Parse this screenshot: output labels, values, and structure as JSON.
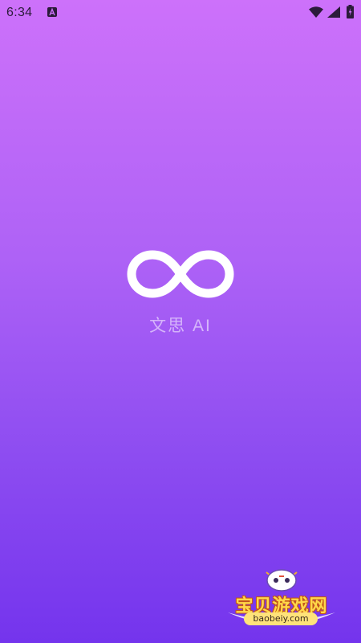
{
  "status_bar": {
    "time": "6:34",
    "notification_icon": "app-notification-icon",
    "icons": [
      "wifi-icon",
      "signal-icon",
      "battery-icon"
    ]
  },
  "splash": {
    "logo_icon": "infinity-logo-icon",
    "app_name": "文思 AI",
    "background_colors": [
      "#cd71fa",
      "#7434ed"
    ]
  },
  "watermark": {
    "title": "宝贝游戏网",
    "url": "baobeiy.com",
    "mascot_icon": "gamepad-mascot-icon"
  }
}
